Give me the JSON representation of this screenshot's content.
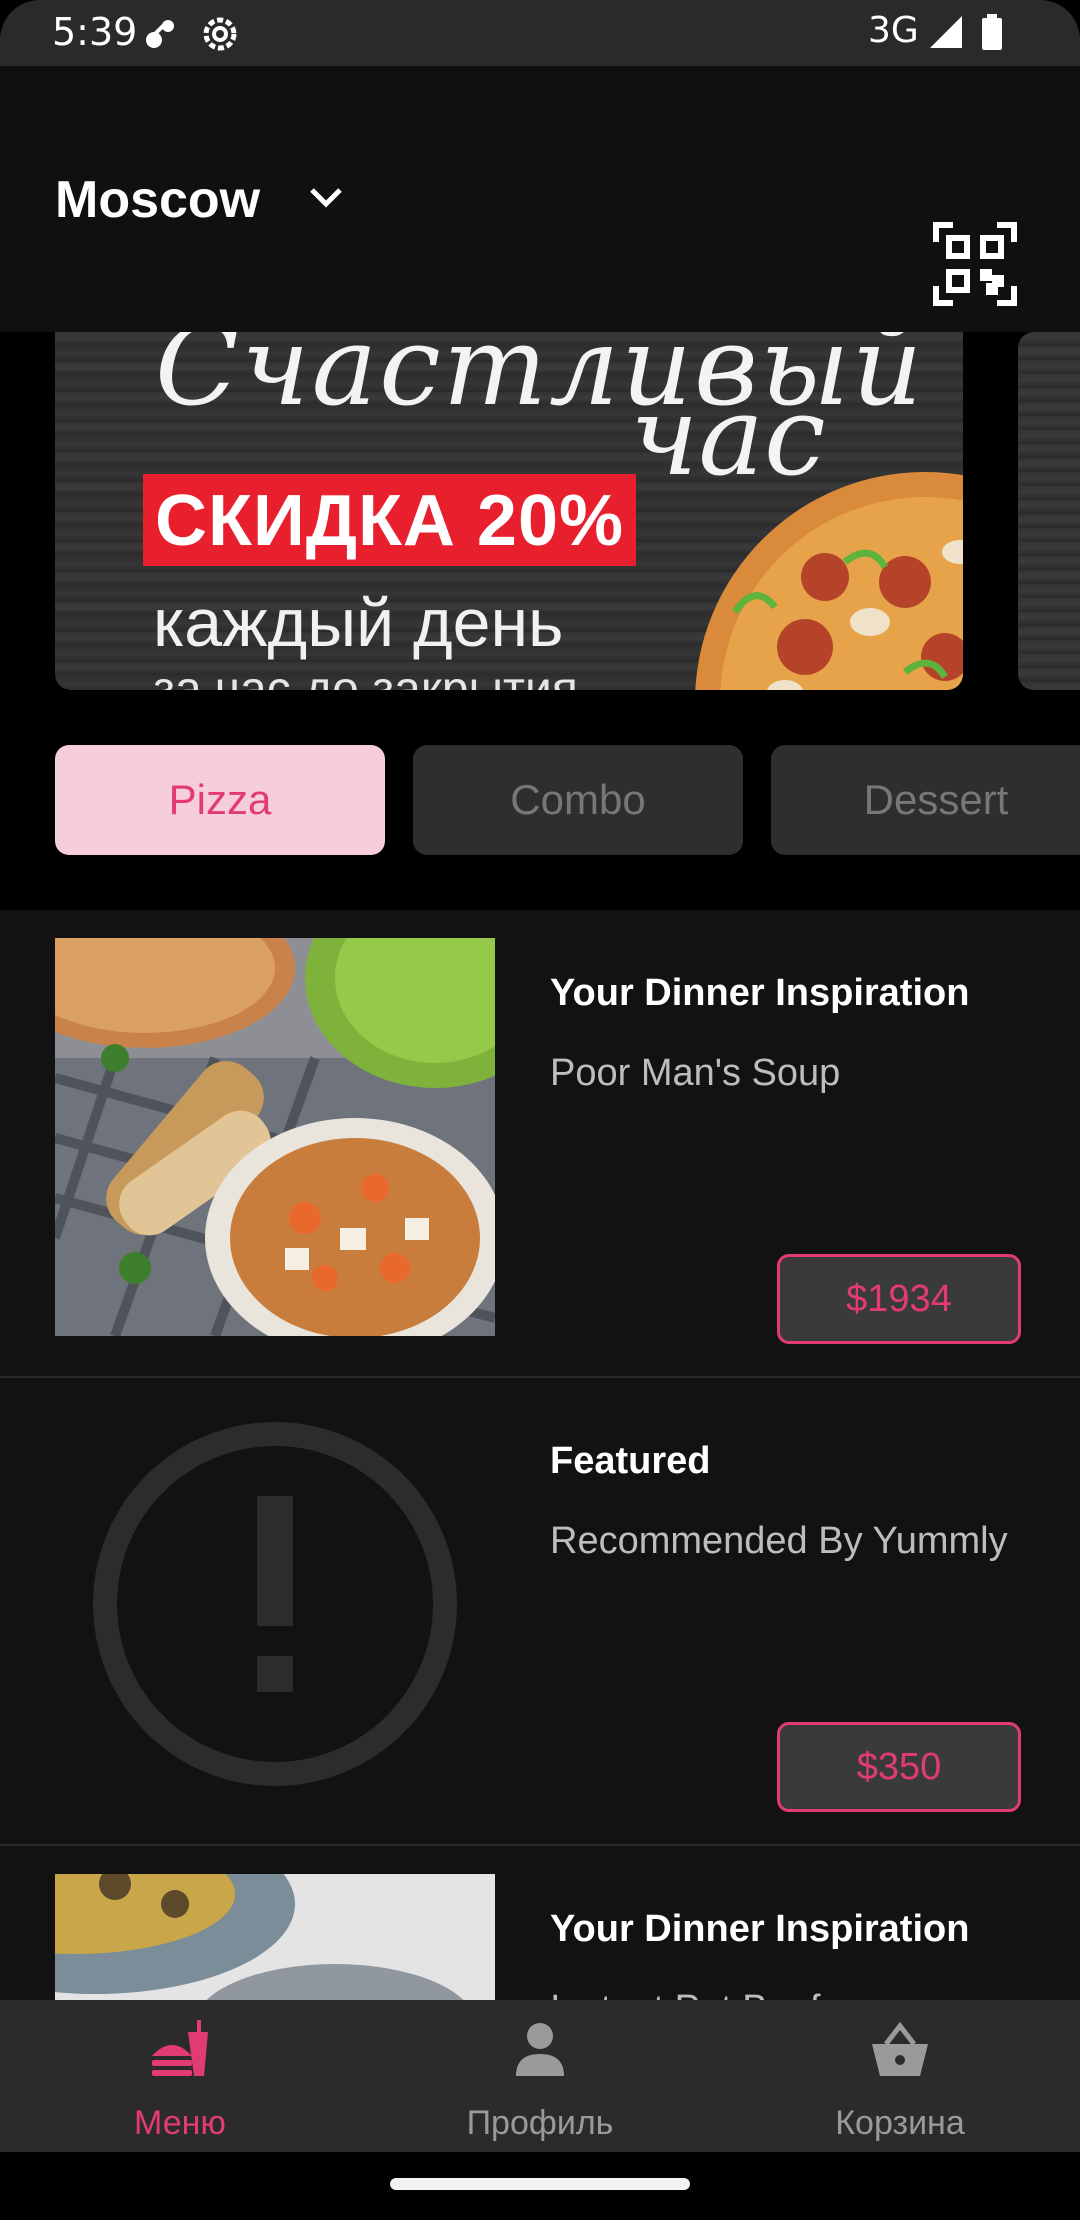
{
  "status_bar": {
    "time": "5:39",
    "network": "3G"
  },
  "header": {
    "city": "Moscow"
  },
  "banner": {
    "script_line1": "Счастливый",
    "script_line2": "час",
    "promo": "СКИДКА 20%",
    "line2": "каждый день",
    "line3": "за час до закрытия"
  },
  "categories": [
    {
      "label": "Pizza",
      "active": true
    },
    {
      "label": "Combo",
      "active": false
    },
    {
      "label": "Dessert",
      "active": false
    }
  ],
  "items": [
    {
      "title": "Your Dinner Inspiration",
      "subtitle": "Poor Man's Soup",
      "price": "$1934"
    },
    {
      "title": "Featured",
      "subtitle": "Recommended By Yummly",
      "price": "$350"
    },
    {
      "title": "Your Dinner Inspiration",
      "subtitle": "Instant Pot Beef"
    }
  ],
  "bottom_nav": [
    {
      "label": "Меню",
      "icon": "fastfood-icon",
      "active": true
    },
    {
      "label": "Профиль",
      "icon": "person-icon",
      "active": false
    },
    {
      "label": "Корзина",
      "icon": "basket-icon",
      "active": false
    }
  ],
  "colors": {
    "accent": "#e23b74",
    "chip_active_bg": "#f6cedb",
    "promo_red": "#e8202e"
  }
}
